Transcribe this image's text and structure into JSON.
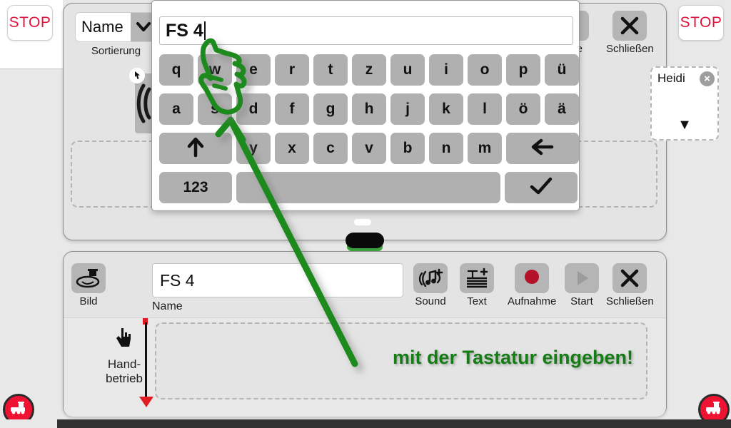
{
  "app": {
    "background_color": "#e8e8e8",
    "accent_green": "#167d16",
    "accent_red": "#ef1233",
    "key_gray": "#b0b0b0"
  },
  "stop_buttons": {
    "left_label": "STOP",
    "right_label": "STOP"
  },
  "upper_window": {
    "sort_select": {
      "value": "Name",
      "caption": "Sortierung",
      "arrow_icon": "chevron-down-icon"
    },
    "media_tile": {
      "icon": "sound-play-icon",
      "badge_icon": "hand-cursor-icon"
    },
    "add_button_label": "+",
    "help_button": {
      "icon": "question-mark-icon",
      "label": "Hilfe"
    },
    "close_button": {
      "icon": "close-x-icon",
      "label": "Schließen"
    },
    "item_card": {
      "name": "Heidi",
      "close_icon": "close-x-icon",
      "dropdown_icon": "triangle-down-icon"
    }
  },
  "keyboard": {
    "input_value": "FS 4",
    "rows": [
      [
        "q",
        "w",
        "e",
        "r",
        "t",
        "z",
        "u",
        "i",
        "o",
        "p",
        "ü"
      ],
      [
        "a",
        "s",
        "d",
        "f",
        "g",
        "h",
        "j",
        "k",
        "l",
        "ö",
        "ä"
      ],
      [
        "⬆",
        "y",
        "x",
        "c",
        "v",
        "b",
        "n",
        "m",
        "⬅"
      ],
      [
        "123",
        "",
        "✓"
      ]
    ],
    "shift_key_icon": "arrow-up-icon",
    "backspace_key_icon": "arrow-left-icon",
    "numeric_key_label": "123",
    "space_key_label": "",
    "enter_key_icon": "checkmark-icon"
  },
  "lower_window": {
    "image_button": {
      "icon": "locomotive-icon",
      "label": "Bild"
    },
    "name_input": {
      "value": "FS 4",
      "label": "Name"
    },
    "tools": [
      {
        "icon": "sound-add-icon",
        "label": "Sound"
      },
      {
        "icon": "text-add-icon",
        "label": "Text"
      },
      {
        "icon": "record-dot-icon",
        "label": "Aufnahme"
      },
      {
        "icon": "play-triangle-icon",
        "label": "Start"
      },
      {
        "icon": "close-x-icon",
        "label": "Schließen"
      }
    ],
    "manual_mode": {
      "icon": "hand-pointer-icon",
      "label_line1": "Hand-",
      "label_line2": "betrieb"
    },
    "annotation": "mit der Tastatur eingeben!"
  },
  "corner_buttons": {
    "left_icon": "locomotive-icon",
    "right_icon": "locomotive-icon"
  },
  "annotation_overlay": {
    "pointer_icon": "green-hand-pointing-icon",
    "arrow_icon": "green-arrow-icon",
    "target_key": "s"
  }
}
